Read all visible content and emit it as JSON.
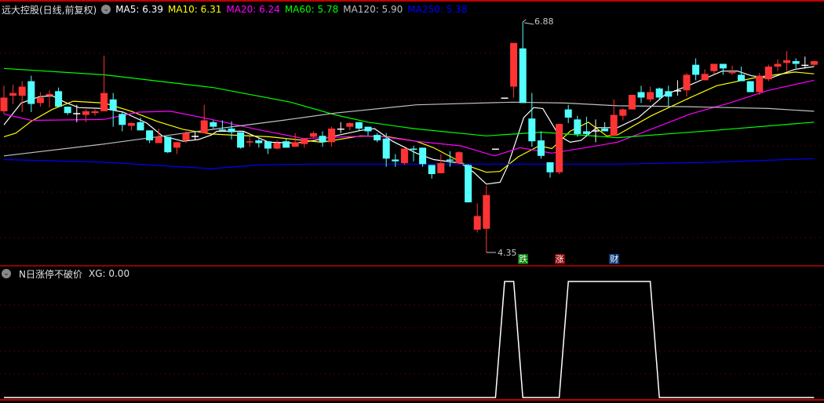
{
  "header": {
    "title": "远大控股(日线,前复权)",
    "ma": [
      {
        "label": "MA5: 6.39",
        "color": "#ffffff"
      },
      {
        "label": "MA10: 6.31",
        "color": "#ffff00"
      },
      {
        "label": "MA20: 6.24",
        "color": "#ff00ff"
      },
      {
        "label": "MA60: 5.78",
        "color": "#00ff00"
      },
      {
        "label": "MA120: 5.90",
        "color": "#c0c0c0"
      },
      {
        "label": "MA250: 5.38",
        "color": "#0000ff"
      }
    ]
  },
  "indicator": {
    "title": "N日涨停不破价",
    "value_label": "XG: 0.00"
  },
  "annotations": {
    "high_label": "6.88",
    "low_label": "4.35"
  },
  "markers": [
    {
      "text": "跌",
      "index": 57,
      "bg": "#007a00"
    },
    {
      "text": "涨",
      "index": 61,
      "bg": "#8b0000"
    },
    {
      "text": "财",
      "index": 67,
      "bg": "#0a3a78"
    }
  ],
  "colors": {
    "up": "#ff3333",
    "down": "#54ffff",
    "flat": "#ffffff",
    "grid": "#8b0000",
    "frame": "#c00000"
  },
  "chart_data": [
    {
      "type": "candlestick",
      "title": "远大控股(日线,前复权)",
      "price_range": [
        4.35,
        6.88
      ],
      "ohlc": [
        [
          5.9,
          6.18,
          5.87,
          6.05
        ],
        [
          6.07,
          6.19,
          5.98,
          6.1
        ],
        [
          6.07,
          6.23,
          5.89,
          6.17
        ],
        [
          6.23,
          6.29,
          5.89,
          5.98
        ],
        [
          5.99,
          6.11,
          5.95,
          6.05
        ],
        [
          6.07,
          6.13,
          5.94,
          6.09
        ],
        [
          6.12,
          6.16,
          5.95,
          5.95
        ],
        [
          5.95,
          5.95,
          5.86,
          5.88
        ],
        [
          5.88,
          5.97,
          5.78,
          5.88
        ],
        [
          5.86,
          5.92,
          5.78,
          5.9
        ],
        [
          5.88,
          5.92,
          5.85,
          5.9
        ],
        [
          5.9,
          6.51,
          5.9,
          6.1
        ],
        [
          6.03,
          6.1,
          5.73,
          5.91
        ],
        [
          5.87,
          5.89,
          5.68,
          5.75
        ],
        [
          5.74,
          5.78,
          5.69,
          5.77
        ],
        [
          5.78,
          5.83,
          5.69,
          5.69
        ],
        [
          5.69,
          5.69,
          5.55,
          5.58
        ],
        [
          5.55,
          5.71,
          5.55,
          5.62
        ],
        [
          5.62,
          5.62,
          5.44,
          5.45
        ],
        [
          5.5,
          5.56,
          5.43,
          5.56
        ],
        [
          5.58,
          5.68,
          5.55,
          5.66
        ],
        [
          5.63,
          5.68,
          5.58,
          5.63
        ],
        [
          5.66,
          5.97,
          5.66,
          5.8
        ],
        [
          5.78,
          5.8,
          5.71,
          5.73
        ],
        [
          5.7,
          5.8,
          5.68,
          5.69
        ],
        [
          5.71,
          5.79,
          5.59,
          5.67
        ],
        [
          5.67,
          5.67,
          5.49,
          5.5
        ],
        [
          5.56,
          5.62,
          5.51,
          5.57
        ],
        [
          5.58,
          5.6,
          5.5,
          5.55
        ],
        [
          5.57,
          5.57,
          5.43,
          5.49
        ],
        [
          5.49,
          5.58,
          5.48,
          5.55
        ],
        [
          5.57,
          5.6,
          5.5,
          5.5
        ],
        [
          5.51,
          5.66,
          5.51,
          5.56
        ],
        [
          5.54,
          5.6,
          5.5,
          5.6
        ],
        [
          5.62,
          5.68,
          5.6,
          5.66
        ],
        [
          5.63,
          5.68,
          5.51,
          5.56
        ],
        [
          5.56,
          5.73,
          5.51,
          5.71
        ],
        [
          5.71,
          5.78,
          5.66,
          5.71
        ],
        [
          5.73,
          5.78,
          5.69,
          5.77
        ],
        [
          5.78,
          5.78,
          5.68,
          5.71
        ],
        [
          5.73,
          5.73,
          5.63,
          5.68
        ],
        [
          5.64,
          5.66,
          5.56,
          5.58
        ],
        [
          5.6,
          5.66,
          5.29,
          5.38
        ],
        [
          5.37,
          5.43,
          5.29,
          5.35
        ],
        [
          5.33,
          5.49,
          5.31,
          5.49
        ],
        [
          5.49,
          5.52,
          5.35,
          5.48
        ],
        [
          5.5,
          5.5,
          5.29,
          5.32
        ],
        [
          5.31,
          5.31,
          5.16,
          5.21
        ],
        [
          5.22,
          5.43,
          5.22,
          5.33
        ],
        [
          5.37,
          5.46,
          5.29,
          5.36
        ],
        [
          5.33,
          5.46,
          5.33,
          5.45
        ],
        [
          5.31,
          5.32,
          4.9,
          4.9
        ],
        [
          4.6,
          4.89,
          4.57,
          4.75
        ],
        [
          4.61,
          5.08,
          4.35,
          4.98
        ],
        [
          5.49,
          5.49,
          5.49,
          5.49
        ],
        [
          6.05,
          6.05,
          6.05,
          6.05
        ],
        [
          6.17,
          6.65,
          6.05,
          6.65
        ],
        [
          6.59,
          6.88,
          5.99,
          5.99
        ],
        [
          5.82,
          6.1,
          5.51,
          5.57
        ],
        [
          5.58,
          5.68,
          5.38,
          5.41
        ],
        [
          5.34,
          5.34,
          5.17,
          5.23
        ],
        [
          5.23,
          5.76,
          5.21,
          5.76
        ],
        [
          5.92,
          5.97,
          5.77,
          5.83
        ],
        [
          5.81,
          5.85,
          5.62,
          5.65
        ],
        [
          5.68,
          5.84,
          5.62,
          5.65
        ],
        [
          5.69,
          5.81,
          5.56,
          5.69
        ],
        [
          5.71,
          5.78,
          5.68,
          5.68
        ],
        [
          5.63,
          6.03,
          5.63,
          5.86
        ],
        [
          5.85,
          5.93,
          5.8,
          5.92
        ],
        [
          5.92,
          6.08,
          5.92,
          6.08
        ],
        [
          6.11,
          6.18,
          5.99,
          6.05
        ],
        [
          6.03,
          6.17,
          6.0,
          6.11
        ],
        [
          6.15,
          6.16,
          6.03,
          6.05
        ],
        [
          6.12,
          6.18,
          5.96,
          6.06
        ],
        [
          6.13,
          6.24,
          6.07,
          6.13
        ],
        [
          6.13,
          6.32,
          6.06,
          6.3
        ],
        [
          6.41,
          6.48,
          6.24,
          6.3
        ],
        [
          6.24,
          6.36,
          6.24,
          6.31
        ],
        [
          6.34,
          6.42,
          6.31,
          6.42
        ],
        [
          6.42,
          6.42,
          6.3,
          6.37
        ],
        [
          6.32,
          6.4,
          6.3,
          6.33
        ],
        [
          6.3,
          6.39,
          6.23,
          6.23
        ],
        [
          6.23,
          6.23,
          6.11,
          6.11
        ],
        [
          6.11,
          6.32,
          6.08,
          6.29
        ],
        [
          6.25,
          6.41,
          6.23,
          6.39
        ],
        [
          6.39,
          6.47,
          6.34,
          6.42
        ],
        [
          6.43,
          6.56,
          6.34,
          6.46
        ],
        [
          6.45,
          6.48,
          6.37,
          6.42
        ],
        [
          6.41,
          6.5,
          6.37,
          6.41
        ],
        [
          6.41,
          6.45,
          6.4,
          6.45
        ]
      ],
      "ma_series": [
        {
          "name": "MA5",
          "color": "#ffffff",
          "points": [
            [
              0,
              5.75
            ],
            [
              1.9,
              5.99
            ],
            [
              3.9,
              6.06
            ],
            [
              5.3,
              6.07
            ],
            [
              6.7,
              6.0
            ],
            [
              8.2,
              5.94
            ],
            [
              11,
              5.93
            ],
            [
              13.1,
              5.89
            ],
            [
              15.7,
              5.77
            ],
            [
              17.4,
              5.63
            ],
            [
              19.7,
              5.57
            ],
            [
              21.4,
              5.59
            ],
            [
              22.8,
              5.64
            ],
            [
              23.4,
              5.68
            ],
            [
              26.3,
              5.68
            ],
            [
              29.1,
              5.56
            ],
            [
              32.1,
              5.55
            ],
            [
              34.1,
              5.58
            ],
            [
              36.4,
              5.63
            ],
            [
              39.2,
              5.69
            ],
            [
              40.7,
              5.71
            ],
            [
              42.7,
              5.57
            ],
            [
              45.3,
              5.44
            ],
            [
              47.2,
              5.37
            ],
            [
              50.2,
              5.33
            ],
            [
              51.6,
              5.23
            ],
            [
              53,
              5.1
            ],
            [
              54.5,
              5.12
            ],
            [
              55.3,
              5.29
            ],
            [
              57.1,
              5.83
            ],
            [
              58.2,
              5.94
            ],
            [
              59.2,
              5.93
            ],
            [
              61,
              5.63
            ],
            [
              62.2,
              5.56
            ],
            [
              63.4,
              5.58
            ],
            [
              65.1,
              5.72
            ],
            [
              67.4,
              5.72
            ],
            [
              69.7,
              5.83
            ],
            [
              72.6,
              6.08
            ],
            [
              75.4,
              6.19
            ],
            [
              78.9,
              6.34
            ],
            [
              80.6,
              6.34
            ],
            [
              82.1,
              6.29
            ],
            [
              84.1,
              6.26
            ],
            [
              86.9,
              6.36
            ],
            [
              89,
              6.39
            ]
          ]
        },
        {
          "name": "MA10",
          "color": "#ffff00",
          "points": [
            [
              0,
              5.62
            ],
            [
              1.3,
              5.66
            ],
            [
              3,
              5.79
            ],
            [
              5.3,
              5.92
            ],
            [
              7.6,
              6.01
            ],
            [
              11,
              5.99
            ],
            [
              14,
              5.9
            ],
            [
              16.8,
              5.79
            ],
            [
              19.7,
              5.7
            ],
            [
              22.8,
              5.65
            ],
            [
              24.8,
              5.64
            ],
            [
              29.1,
              5.62
            ],
            [
              34.9,
              5.56
            ],
            [
              39.2,
              5.63
            ],
            [
              42.1,
              5.62
            ],
            [
              45.3,
              5.57
            ],
            [
              47.2,
              5.5
            ],
            [
              51,
              5.3
            ],
            [
              53,
              5.23
            ],
            [
              54.5,
              5.24
            ],
            [
              56.5,
              5.4
            ],
            [
              58.8,
              5.52
            ],
            [
              60.2,
              5.49
            ],
            [
              62.2,
              5.68
            ],
            [
              64.2,
              5.78
            ],
            [
              66.2,
              5.63
            ],
            [
              67.4,
              5.64
            ],
            [
              71.1,
              5.85
            ],
            [
              75.4,
              6.05
            ],
            [
              78.3,
              6.18
            ],
            [
              82.6,
              6.27
            ],
            [
              86.9,
              6.33
            ],
            [
              89,
              6.31
            ]
          ]
        },
        {
          "name": "MA20",
          "color": "#ff00ff",
          "points": [
            [
              0,
              5.87
            ],
            [
              3,
              5.8
            ],
            [
              11,
              5.81
            ],
            [
              14.8,
              5.89
            ],
            [
              18.3,
              5.9
            ],
            [
              22.8,
              5.81
            ],
            [
              27.8,
              5.7
            ],
            [
              32.9,
              5.6
            ],
            [
              37.8,
              5.62
            ],
            [
              41,
              5.63
            ],
            [
              45.3,
              5.57
            ],
            [
              47.2,
              5.55
            ],
            [
              50.2,
              5.52
            ],
            [
              53.9,
              5.41
            ],
            [
              56.7,
              5.5
            ],
            [
              60.2,
              5.44
            ],
            [
              64.5,
              5.51
            ],
            [
              67.4,
              5.56
            ],
            [
              75.4,
              5.87
            ],
            [
              79.7,
              5.99
            ],
            [
              84,
              6.13
            ],
            [
              89,
              6.24
            ]
          ]
        },
        {
          "name": "MA60",
          "color": "#00ff00",
          "points": [
            [
              0,
              6.37
            ],
            [
              11,
              6.3
            ],
            [
              23,
              6.16
            ],
            [
              31.5,
              6.0
            ],
            [
              36.4,
              5.86
            ],
            [
              40,
              5.78
            ],
            [
              45,
              5.71
            ],
            [
              53,
              5.63
            ],
            [
              59,
              5.67
            ],
            [
              67.4,
              5.61
            ],
            [
              78,
              5.69
            ],
            [
              89,
              5.78
            ]
          ]
        },
        {
          "name": "MA120",
          "color": "#c0c0c0",
          "points": [
            [
              0,
              5.41
            ],
            [
              11,
              5.54
            ],
            [
              22.8,
              5.7
            ],
            [
              30.6,
              5.8
            ],
            [
              36.4,
              5.88
            ],
            [
              45.3,
              5.97
            ],
            [
              55.9,
              6.0
            ],
            [
              61.6,
              5.99
            ],
            [
              67.4,
              5.96
            ],
            [
              75.4,
              5.95
            ],
            [
              84,
              5.93
            ],
            [
              89,
              5.9
            ]
          ]
        },
        {
          "name": "MA250",
          "color": "#0000ff",
          "points": [
            [
              0,
              5.37
            ],
            [
              11,
              5.34
            ],
            [
              22.8,
              5.27
            ],
            [
              28,
              5.31
            ],
            [
              34,
              5.32
            ],
            [
              45.3,
              5.32
            ],
            [
              67.4,
              5.32
            ],
            [
              78,
              5.34
            ],
            [
              89,
              5.38
            ]
          ]
        }
      ]
    },
    {
      "type": "line",
      "title": "N日涨停不破价",
      "series": [
        {
          "name": "XG",
          "values": [
            0,
            0,
            0,
            0,
            0,
            0,
            0,
            0,
            0,
            0,
            0,
            0,
            0,
            0,
            0,
            0,
            0,
            0,
            0,
            0,
            0,
            0,
            0,
            0,
            0,
            0,
            0,
            0,
            0,
            0,
            0,
            0,
            0,
            0,
            0,
            0,
            0,
            0,
            0,
            0,
            0,
            0,
            0,
            0,
            0,
            0,
            0,
            0,
            0,
            0,
            0,
            0,
            0,
            0,
            0,
            1,
            1,
            0,
            0,
            0,
            0,
            0,
            1,
            1,
            1,
            1,
            1,
            1,
            1,
            1,
            1,
            1,
            0,
            0,
            0,
            0,
            0,
            0,
            0,
            0,
            0,
            0,
            0,
            0,
            0,
            0,
            0,
            0,
            0,
            0
          ]
        }
      ],
      "ylim": [
        0,
        1
      ]
    }
  ]
}
